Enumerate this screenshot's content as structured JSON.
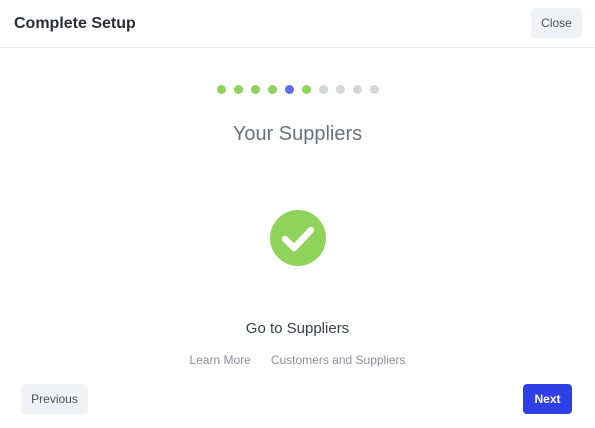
{
  "header": {
    "title": "Complete Setup",
    "close_label": "Close"
  },
  "progress": {
    "total_steps": 10,
    "current_step": 5,
    "completed_steps": [
      1,
      2,
      3,
      4,
      6
    ],
    "colors": {
      "done": "#8fd35a",
      "current": "#5b6fe8",
      "pending": "#d3d7dc"
    }
  },
  "main": {
    "section_title": "Your Suppliers",
    "status_icon": "check-circle-icon",
    "status_color": "#8fd35a",
    "action_label": "Go to Suppliers",
    "links": [
      {
        "label": "Learn More"
      },
      {
        "label": "Customers and Suppliers"
      }
    ]
  },
  "footer": {
    "previous_label": "Previous",
    "next_label": "Next",
    "accent": "#2f3fe8"
  }
}
